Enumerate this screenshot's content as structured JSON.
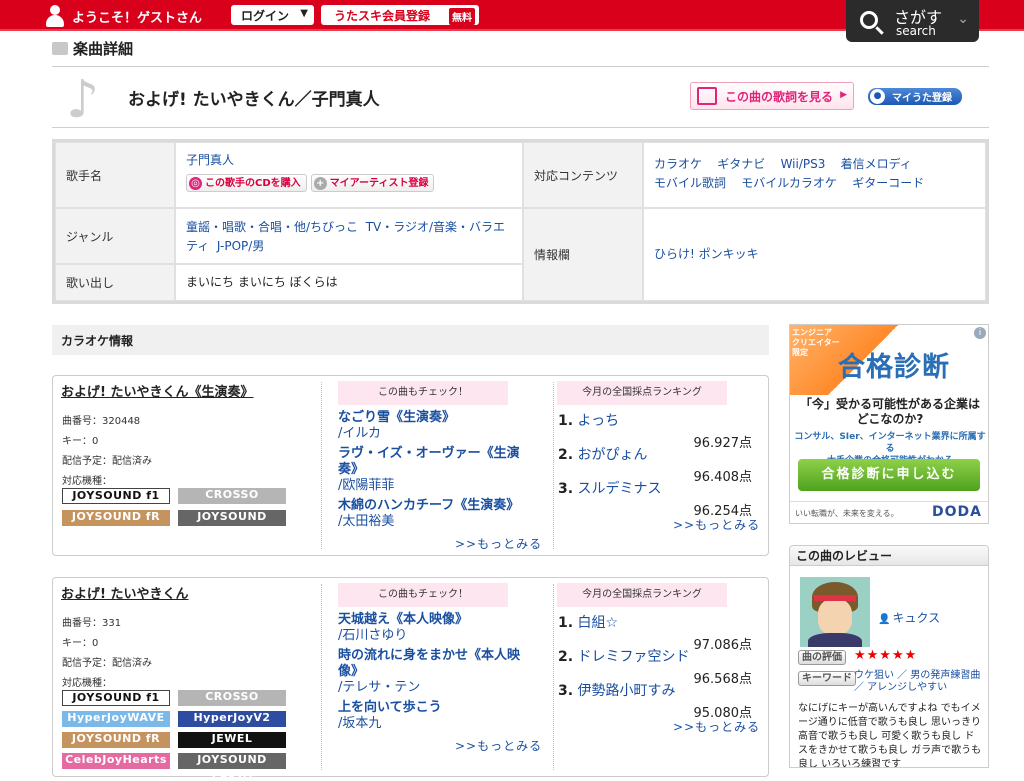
{
  "header": {
    "welcome": "ようこそ！ゲストさん",
    "login_label": "ログイン",
    "register_label": "うたスキ会員登録",
    "register_badge": "無料",
    "search_jp": "さがす",
    "search_en": "search"
  },
  "section_title": "楽曲詳細",
  "song": {
    "title": "およげ! たいやきくん／子門真人",
    "lyrics_button": "この曲の歌詞を見る",
    "myuta_button": "マイうた登録"
  },
  "info": {
    "artist_label": "歌手名",
    "artist_name": "子門真人",
    "buy_cd": "この歌手のCDを購入",
    "my_artist": "マイアーティスト登録",
    "genre_label": "ジャンル",
    "genre_line1": "童謡・唱歌・合唱・他/ちびっこ",
    "genre_line1b": "TV・ラジオ/音楽・バラエ",
    "genre_line2a": "ティ",
    "genre_line2b": "J-POP/男",
    "start_label": "歌い出し",
    "start_text": "まいにち まいにち ぼくらは",
    "content_label": "対応コンテンツ",
    "contents_row1": [
      "カラオケ",
      "ギタナビ",
      "Wii/PS3",
      "着信メロディ"
    ],
    "contents_row2": [
      "モバイル歌詞",
      "モバイルカラオケ",
      "ギターコード"
    ],
    "info_label": "情報欄",
    "info_value": "ひらけ! ポンキッキ"
  },
  "karaoke_title": "カラオケ情報",
  "karaoke": [
    {
      "title": "およげ! たいやきくん《生演奏》",
      "number": "曲番号：320448",
      "key": "キー：0",
      "delivery": "配信予定：配信済み",
      "models_label": "対応機種：",
      "models": [
        "JOYSOUND f1",
        "CROSSO",
        "JOYSOUND fR",
        "JOYSOUND FESTA"
      ],
      "check_head": "この曲もチェック！",
      "recs": [
        {
          "song": "なごり雪《生演奏》",
          "artist": "/イルカ"
        },
        {
          "song": "ラヴ・イズ・オーヴァー《生演",
          "song2": "奏》",
          "artist": "/欧陽菲菲"
        },
        {
          "song": "木綿のハンカチーフ《生演奏》",
          "artist": "/太田裕美"
        }
      ],
      "more": ">>もっとみる",
      "rank_head": "今月の全国採点ランキング",
      "ranks": [
        {
          "n": "1.",
          "name": "よっち",
          "score": "96.927点"
        },
        {
          "n": "2.",
          "name": "おがぴょん",
          "score": "96.408点"
        },
        {
          "n": "3.",
          "name": "スルデミナス",
          "score": "96.254点"
        }
      ],
      "rank_more": ">>もっとみる"
    },
    {
      "title": "およげ! たいやきくん",
      "number": "曲番号：331",
      "key": "キー：0",
      "delivery": "配信予定：配信済み",
      "models_label": "対応機種：",
      "models": [
        "JOYSOUND f1",
        "CROSSO",
        "HyperJoyWAVE",
        "HyperJoyV2",
        "JOYSOUND fR",
        "JEWEL",
        "CelebJoyHearts",
        "JOYSOUND FESTA"
      ],
      "check_head": "この曲もチェック！",
      "recs": [
        {
          "song": "天城越え《本人映像》",
          "artist": "/石川さゆり"
        },
        {
          "song": "時の流れに身をまかせ《本人映",
          "song2": "像》",
          "artist": "/テレサ・テン"
        },
        {
          "song": "上を向いて歩こう",
          "artist": "/坂本九"
        }
      ],
      "more": ">>もっとみる",
      "rank_head": "今月の全国採点ランキング",
      "ranks": [
        {
          "n": "1.",
          "name": "白組☆",
          "score": "97.086点"
        },
        {
          "n": "2.",
          "name": "ドレミファ空シド",
          "score": "96.568点"
        },
        {
          "n": "3.",
          "name": "伊勢路小町すみ",
          "score": "95.080点"
        }
      ],
      "rank_more": ">>もっとみる"
    }
  ],
  "ad": {
    "badge": "エンジニア クリエイター 限定",
    "headline": "合格診断",
    "question1": "「今」受かる可能性がある企業は",
    "question2": "どこなのか?",
    "desc1": "コンサル、SIer、インターネット業界に所属する",
    "desc2": "大手企業の合格可能性がわかる",
    "cta": "合格診断に申し込む",
    "footer": "いい転職が、未来を変える。",
    "logo": "DODA"
  },
  "review": {
    "title": "この曲のレビュー",
    "username": "キュクス",
    "rating_label": "曲の評価",
    "stars": "★★★★★",
    "keyword_label": "キーワード",
    "keywords": "ウケ狙い ／ 男の発声練習曲 ／ アレンジしやすい",
    "body": "なにげにキーが高いんですよね でもイメージ通りに低音で歌うも良し 思いっきり高音で歌うも良し 可愛く歌うも良し ドスをきかせて歌うも良し ガラ声で歌うも良し いろいろ練習です"
  }
}
